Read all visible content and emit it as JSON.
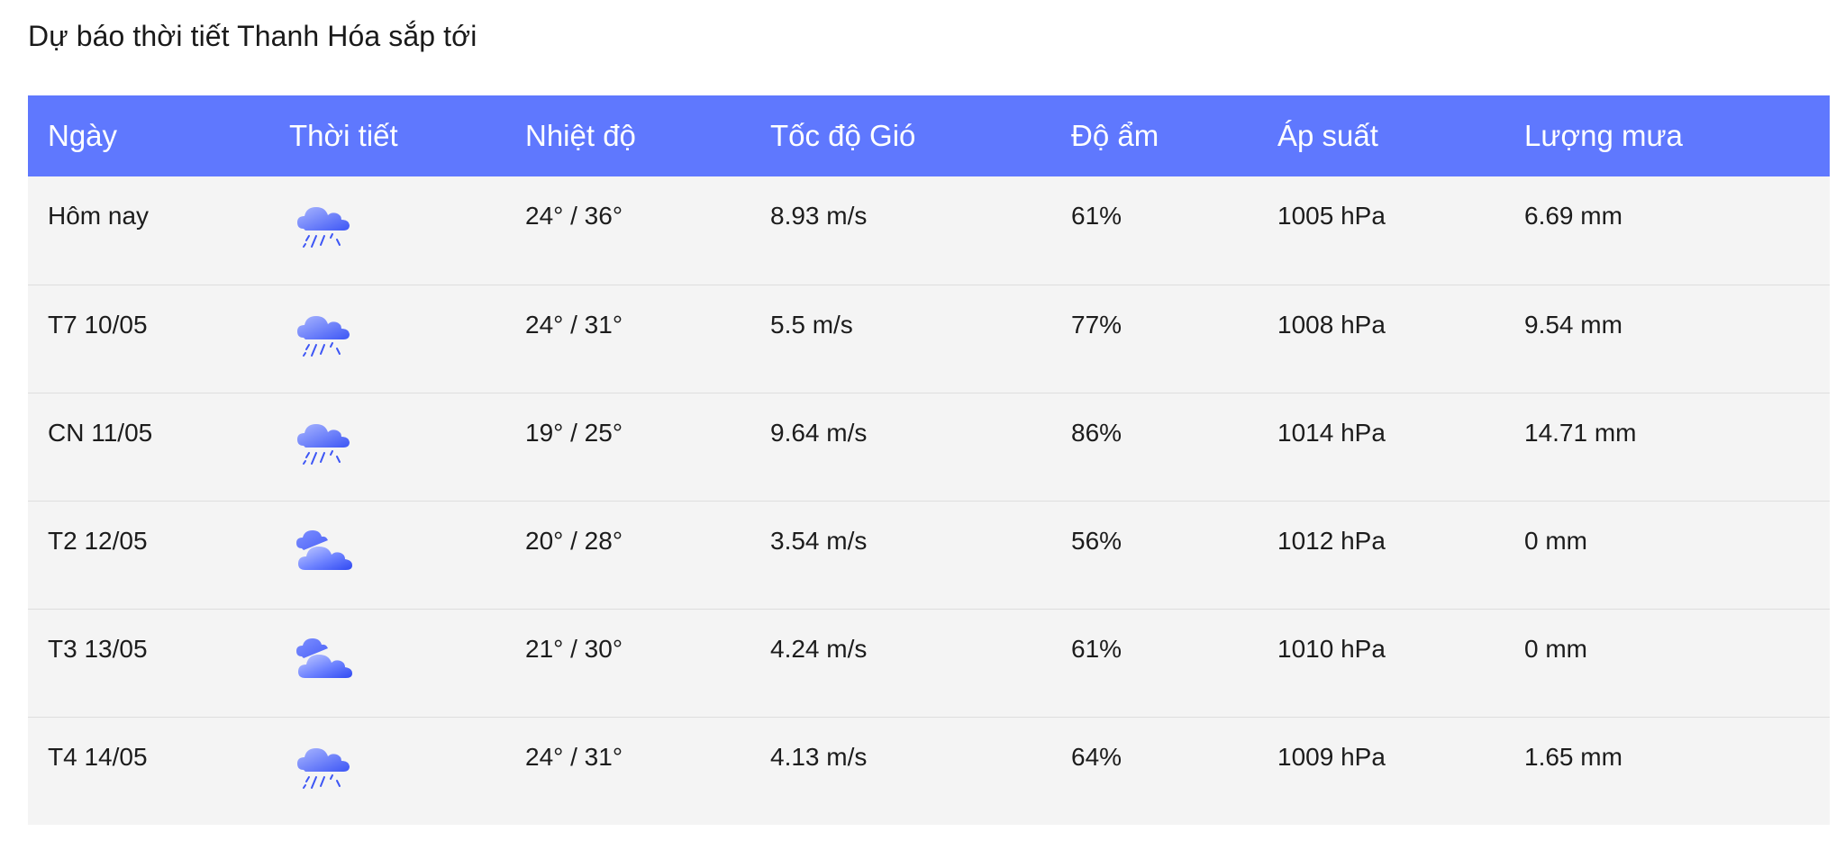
{
  "page": {
    "title": "Dự báo thời tiết Thanh Hóa sắp tới"
  },
  "table": {
    "headers": [
      "Ngày",
      "Thời tiết",
      "Nhiệt độ",
      "Tốc độ Gió",
      "Độ ẩm",
      "Áp suất",
      "Lượng mưa"
    ],
    "rows": [
      {
        "day": "Hôm nay",
        "icon": "rain-cloud-icon",
        "temp": "24° / 36°",
        "wind": "8.93 m/s",
        "humidity": "61%",
        "pressure": "1005 hPa",
        "rain": "6.69 mm"
      },
      {
        "day": "T7 10/05",
        "icon": "rain-cloud-icon",
        "temp": "24° / 31°",
        "wind": "5.5 m/s",
        "humidity": "77%",
        "pressure": "1008 hPa",
        "rain": "9.54 mm"
      },
      {
        "day": "CN 11/05",
        "icon": "rain-cloud-icon",
        "temp": "19° / 25°",
        "wind": "9.64 m/s",
        "humidity": "86%",
        "pressure": "1014 hPa",
        "rain": "14.71 mm"
      },
      {
        "day": "T2 12/05",
        "icon": "overcast-clouds-icon",
        "temp": "20° / 28°",
        "wind": "3.54 m/s",
        "humidity": "56%",
        "pressure": "1012 hPa",
        "rain": "0 mm"
      },
      {
        "day": "T3 13/05",
        "icon": "overcast-clouds-icon",
        "temp": "21° / 30°",
        "wind": "4.24 m/s",
        "humidity": "61%",
        "pressure": "1010 hPa",
        "rain": "0 mm"
      },
      {
        "day": "T4 14/05",
        "icon": "rain-cloud-icon",
        "temp": "24° / 31°",
        "wind": "4.13 m/s",
        "humidity": "64%",
        "pressure": "1009 hPa",
        "rain": "1.65 mm"
      }
    ]
  },
  "colors": {
    "header_bg": "#5f78fe",
    "row_bg": "#f4f4f4",
    "icon_blue": "#3d56f5"
  }
}
